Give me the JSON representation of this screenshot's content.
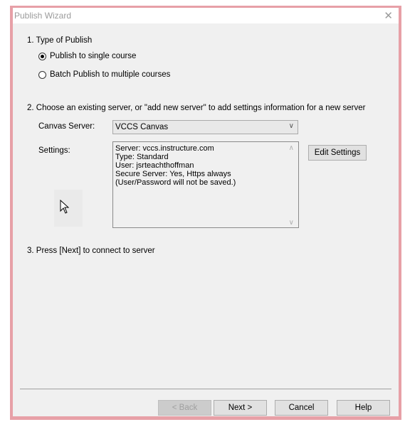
{
  "window": {
    "title": "Publish Wizard",
    "close_glyph": "✕"
  },
  "steps": {
    "step1": "1.  Type of Publish",
    "step2": "2.  Choose an existing server, or \"add new server\" to add settings information for a new server",
    "step3": "3.  Press [Next] to connect to server"
  },
  "publish_type": {
    "options": [
      {
        "label": "Publish to single course",
        "selected": true
      },
      {
        "label": "Batch Publish to multiple courses",
        "selected": false
      }
    ]
  },
  "server": {
    "label": "Canvas Server:",
    "selected": "VCCS Canvas",
    "chevron": "∨"
  },
  "settings": {
    "label": "Settings:",
    "lines": [
      "Server: vccs.instructure.com",
      "Type: Standard",
      "User: jsrteachthoffman",
      "Secure Server: Yes, Https always",
      "(User/Password will not be saved.)"
    ],
    "scroll_up": "∧",
    "scroll_down": "∨",
    "edit_button": "Edit Settings"
  },
  "footer": {
    "back": "< Back",
    "next": "Next >",
    "cancel": "Cancel",
    "help": "Help"
  },
  "colors": {
    "frame": "#e7a0a7",
    "dialog_bg": "#f0f0f0"
  }
}
